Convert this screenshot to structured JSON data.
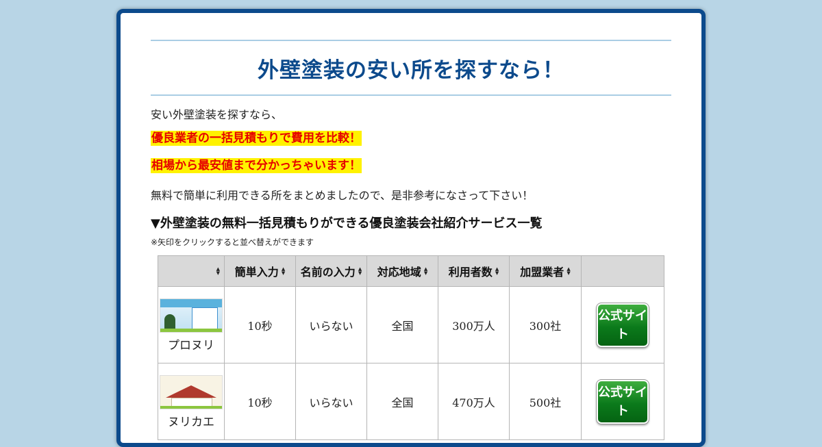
{
  "page": {
    "title": "外壁塗装の安い所を探すなら！",
    "intro": "安い外壁塗装を探すなら、",
    "highlight_1": "優良業者の一括見積もりで費用を比較！",
    "highlight_2": "相場から最安値まで分かっちゃいます！",
    "summary": "無料で簡単に利用できる所をまとめましたので、是非参考になさって下さい！",
    "section_title": "▼外壁塗装の無料一括見積もりができる優良塗装会社紹介サービス一覧",
    "sort_note": "※矢印をクリックすると並べ替えができます"
  },
  "table": {
    "columns": [
      "",
      "簡単入力",
      "名前の入力",
      "対応地域",
      "利用者数",
      "加盟業者",
      ""
    ],
    "rows": [
      {
        "name": "プロヌリ",
        "input_time": "10秒",
        "name_required": "いらない",
        "area": "全国",
        "users": "300万人",
        "members": "300社",
        "button_label": "公式サイト"
      },
      {
        "name": "ヌリカエ",
        "input_time": "10秒",
        "name_required": "いらない",
        "area": "全国",
        "users": "470万人",
        "members": "500社",
        "button_label": "公式サイト"
      }
    ]
  },
  "colors": {
    "background": "#b8d5e6",
    "frame": "#0c4a8c",
    "title": "#0c4a8c",
    "highlight_text": "#e60000",
    "highlight_bg": "#fff200",
    "button": "#0b7a1b"
  },
  "icons": {
    "sort": "sort-arrows-icon"
  }
}
